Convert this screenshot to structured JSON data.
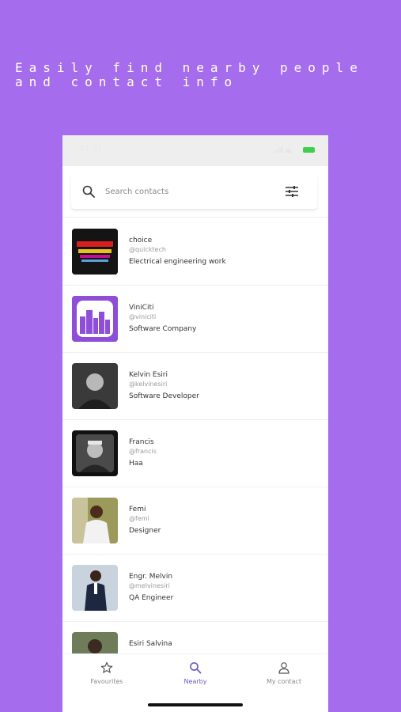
{
  "headline": "Easily find nearby people and contact info",
  "search": {
    "placeholder": "Search contacts"
  },
  "contacts": [
    {
      "name": "choice",
      "handle": "@quicktech",
      "role": "Electrical engineering work",
      "avatar": "quicktech-logo"
    },
    {
      "name": "ViniCiti",
      "handle": "@viniciti",
      "role": "Software Company",
      "avatar": "city-buildings-logo"
    },
    {
      "name": "Kelvin Esiri",
      "handle": "@kelvinesiri",
      "role": "Software Developer",
      "avatar": "profile-photo"
    },
    {
      "name": "Francis",
      "handle": "@francis",
      "role": "Haa",
      "avatar": "profile-photo"
    },
    {
      "name": "Femi",
      "handle": "@femi",
      "role": "Designer",
      "avatar": "profile-photo"
    },
    {
      "name": "Engr. Melvin",
      "handle": "@melvinesiri",
      "role": "QA Engineer",
      "avatar": "profile-photo"
    },
    {
      "name": "Esiri Salvina",
      "handle": "",
      "role": "",
      "avatar": "profile-photo"
    }
  ],
  "tabs": [
    {
      "label": "Favourites",
      "icon": "star-icon",
      "active": false
    },
    {
      "label": "Nearby",
      "icon": "search-icon",
      "active": true
    },
    {
      "label": "My contact",
      "icon": "user-icon",
      "active": false
    }
  ],
  "colors": {
    "background": "#a56ded",
    "accent": "#6a58c8",
    "battery": "#3fcf4d"
  }
}
